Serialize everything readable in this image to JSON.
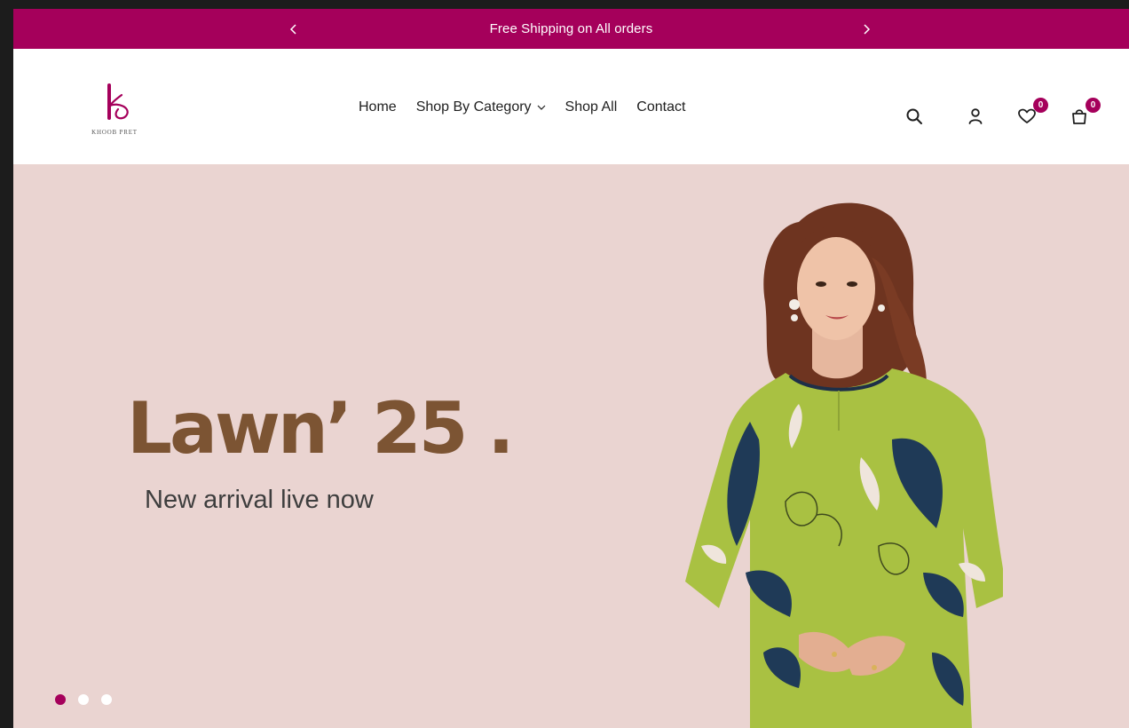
{
  "colors": {
    "brand": "#a5005b",
    "hero_background": "#ead4d1",
    "hero_title": "#7c5433"
  },
  "announcement": {
    "text": "Free Shipping on All orders",
    "prev_icon": "chevron-left-icon",
    "next_icon": "chevron-right-icon"
  },
  "logo": {
    "letter": "k",
    "brand_text": "KHOOB PRET"
  },
  "nav": {
    "items": [
      {
        "label": "Home"
      },
      {
        "label": "Shop By Category",
        "has_dropdown": true
      },
      {
        "label": "Shop All"
      },
      {
        "label": "Contact"
      }
    ]
  },
  "header_icons": {
    "search": "search-icon",
    "account": "user-icon",
    "wishlist": {
      "icon": "heart-icon",
      "count": "0"
    },
    "cart": {
      "icon": "shopping-bag-icon",
      "count": "0"
    }
  },
  "hero": {
    "title": "Lawn’ 25 .",
    "subtitle": "New arrival live now",
    "slides": 3,
    "active_slide": 1
  }
}
